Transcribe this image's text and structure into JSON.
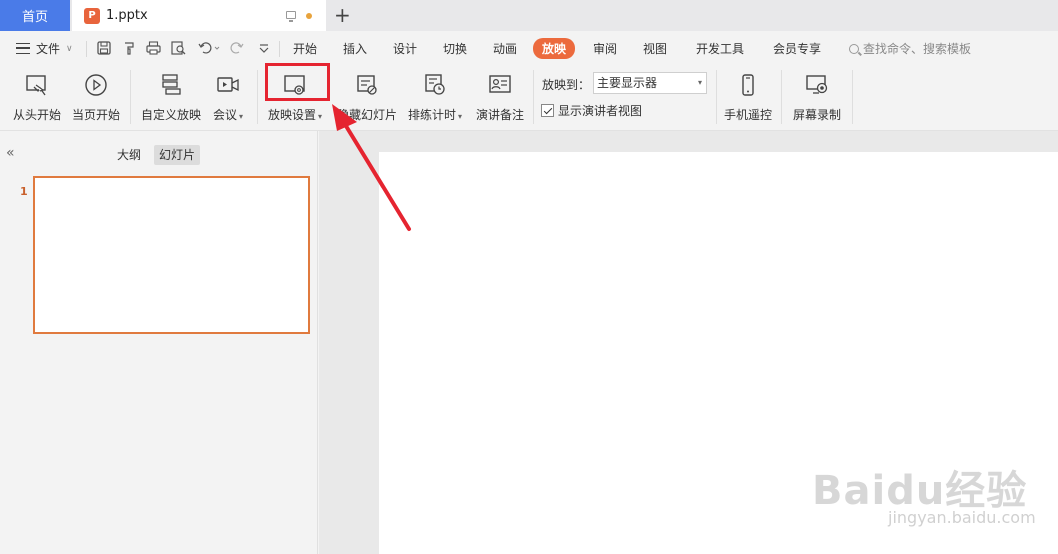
{
  "tabbar": {
    "home": "首页",
    "doc_name": "1.pptx",
    "doc_icon": "P",
    "new_tab": "+"
  },
  "menubar": {
    "file": "文件",
    "tabs": [
      "开始",
      "插入",
      "设计",
      "切换",
      "动画",
      "放映",
      "审阅",
      "视图",
      "开发工具",
      "会员专享"
    ],
    "active_tab": "放映",
    "search": "查找命令、搜索模板"
  },
  "ribbon": {
    "from_start": "从头开始",
    "from_current": "当页开始",
    "custom_show": "自定义放映",
    "meeting": "会议",
    "show_settings": "放映设置",
    "hide_slide": "隐藏幻灯片",
    "rehearse": "排练计时",
    "speaker_notes": "演讲备注",
    "play_to_label": "放映到：",
    "play_to_value": "主要显示器",
    "presenter_view": "显示演讲者视图",
    "presenter_view_checked": true,
    "phone_remote": "手机遥控",
    "screen_record": "屏幕录制"
  },
  "leftpane": {
    "outline_tab": "大纲",
    "slides_tab": "幻灯片",
    "slide_number": "1"
  },
  "watermark": {
    "main": "Baidu经验",
    "sub": "jingyan.baidu.com"
  },
  "colors": {
    "accent": "#ec6a3d",
    "home_tab": "#4a7be8",
    "highlight": "#e52430",
    "thumb_border": "#e07a3e"
  }
}
